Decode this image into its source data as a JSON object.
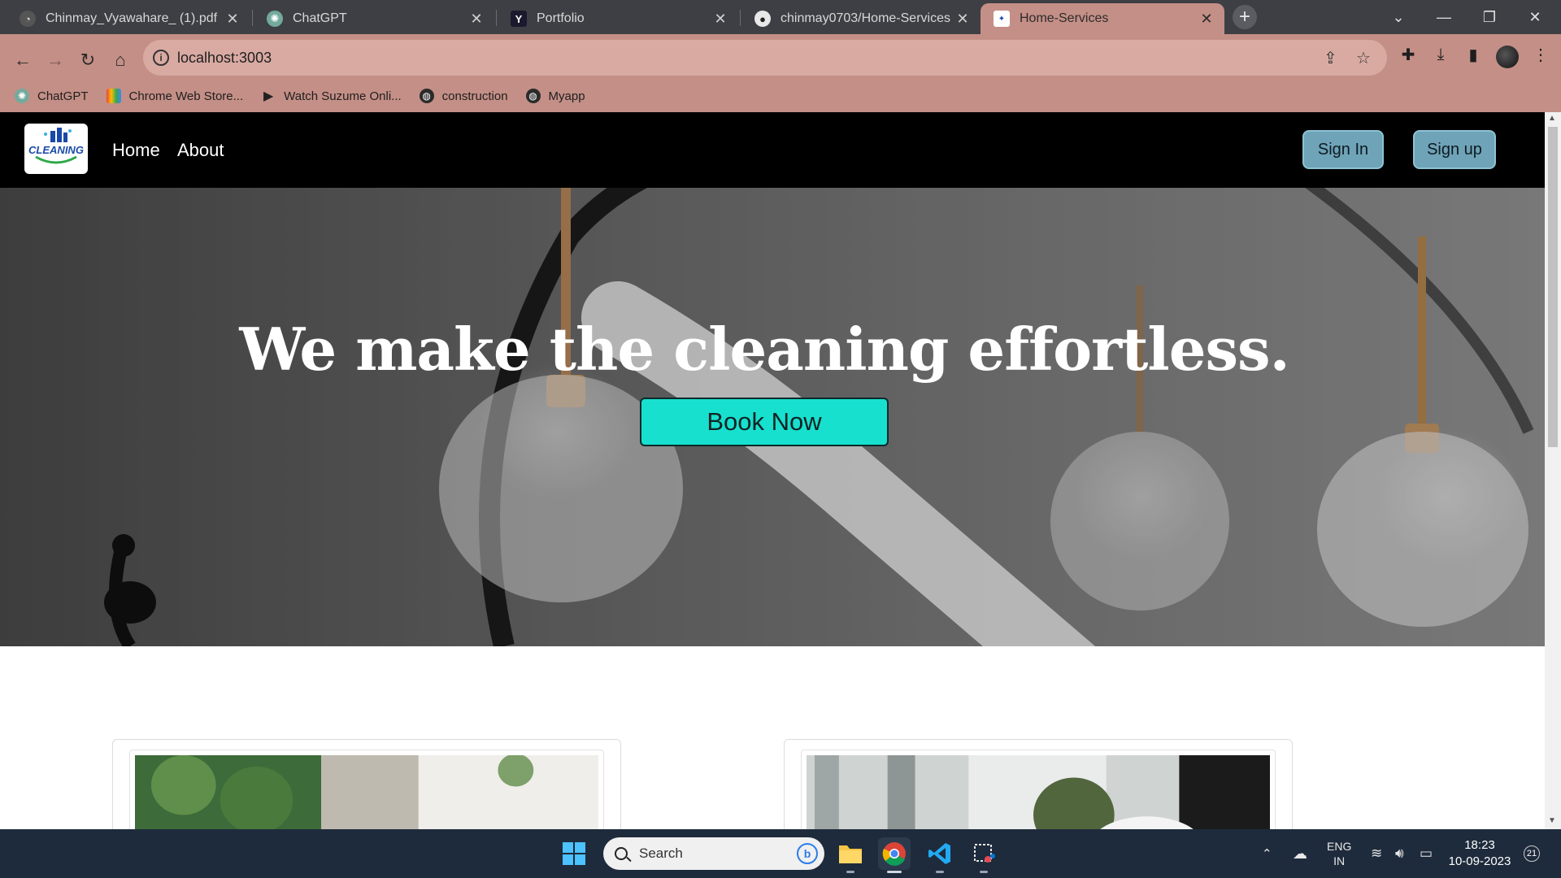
{
  "browser": {
    "tabs": [
      {
        "title": "Chinmay_Vyawahare_ (1).pdf",
        "icon": "pdf-icon"
      },
      {
        "title": "ChatGPT",
        "icon": "chatgpt-icon"
      },
      {
        "title": "Portfolio",
        "icon": "y-icon"
      },
      {
        "title": "chinmay0703/Home-Services",
        "icon": "github-icon"
      },
      {
        "title": "Home-Services",
        "icon": "site-icon",
        "active": true
      }
    ],
    "url": "localhost:3003",
    "bookmarks": [
      {
        "label": "ChatGPT",
        "icon": "chatgpt-icon"
      },
      {
        "label": "Chrome Web Store...",
        "icon": "webstore-icon"
      },
      {
        "label": "Watch Suzume Onli...",
        "icon": "play-icon"
      },
      {
        "label": "construction",
        "icon": "globe-icon"
      },
      {
        "label": "Myapp",
        "icon": "globe-icon"
      }
    ],
    "colors": {
      "theme": "#c48f86",
      "tabstrip": "#3d3f44"
    }
  },
  "site": {
    "logo_text": "CLEANING",
    "nav": {
      "home": "Home",
      "about": "About"
    },
    "auth": {
      "sign_in": "Sign In",
      "sign_up": "Sign up"
    },
    "hero": {
      "title": "We make the cleaning effortless.",
      "cta": "Book Now"
    },
    "colors": {
      "cta": "#17e0cf",
      "auth_button": "#6fa3b7",
      "navbar": "#000000"
    }
  },
  "taskbar": {
    "search_placeholder": "Search",
    "lang_top": "ENG",
    "lang_bottom": "IN",
    "time": "18:23",
    "date": "10-09-2023",
    "notification_count": "21"
  }
}
